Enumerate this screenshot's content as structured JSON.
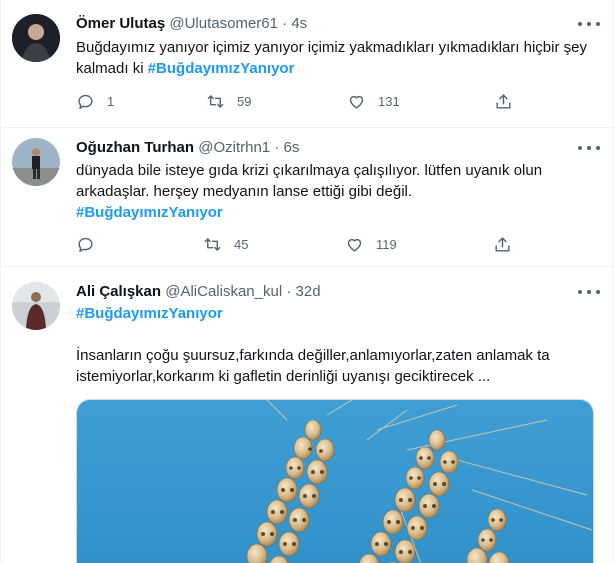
{
  "tweets": [
    {
      "name": "Ömer Ulutaş",
      "handle": "@Ulutasomer61",
      "separator": "·",
      "time": "4s",
      "text_line1": "Buğdayımız yanıyor içimiz yanıyor içimiz yakmadıkları yıkmadıkları hiçbir şey",
      "text_line2_prefix": "kalmadı ki ",
      "hashtag": "#BuğdayımızYanıyor",
      "replies": "1",
      "retweets": "59",
      "likes": "131"
    },
    {
      "name": "Oğuzhan Turhan",
      "handle": "@Ozitrhn1",
      "separator": "·",
      "time": "6s",
      "text_line1": "dünyada bile isteye gıda krizi çıkarılmaya çalışılıyor. lütfen uyanık olun",
      "text_line2": "arkadaşlar. herşey medyanın lanse ettiği gibi değil.",
      "hashtag": "#BuğdayımızYanıyor",
      "replies": "",
      "retweets": "45",
      "likes": "119"
    },
    {
      "name": "Ali Çalışkan",
      "handle": "@AliCaliskan_kul",
      "separator": "·",
      "time": "32d",
      "hashtag": "#BuğdayımızYanıyor",
      "text_line1": "İnsanların çoğu şuursuz,farkında değiller,anlamıyorlar,zaten anlamak ta",
      "text_line2": "istemiyorlar,korkarım ki gafletin derinliği uyanışı geciktirecek ..."
    }
  ],
  "colors": {
    "accent": "#1d9bf0",
    "secondary_text": "#536471",
    "border": "#eff3f4"
  },
  "icons": [
    "reply-icon",
    "retweet-icon",
    "like-icon",
    "share-icon",
    "more-icon"
  ]
}
